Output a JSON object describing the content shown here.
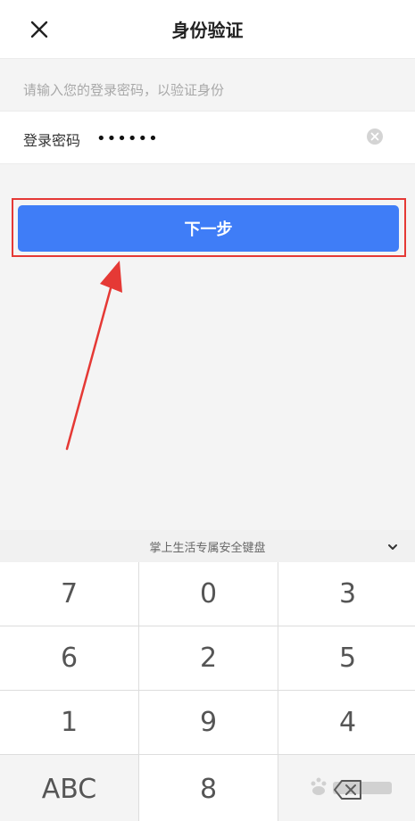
{
  "header": {
    "title": "身份验证",
    "close_icon": "close-icon"
  },
  "form": {
    "hint": "请输入您的登录密码，以验证身份",
    "password_label": "登录密码",
    "password_value": "••••••",
    "clear_icon": "clear-icon"
  },
  "next_button": {
    "label": "下一步"
  },
  "annotation": {
    "color": "#e53935",
    "shape": "red box and arrow pointing to next button"
  },
  "keyboard": {
    "title": "掌上生活专属安全键盘",
    "collapse_icon": "chevron-down-icon",
    "keys": [
      "7",
      "0",
      "3",
      "6",
      "2",
      "5",
      "1",
      "9",
      "4",
      "ABC",
      "8",
      "backspace-icon"
    ]
  },
  "colors": {
    "primary": "#3f7df7",
    "background": "#f4f4f4"
  }
}
